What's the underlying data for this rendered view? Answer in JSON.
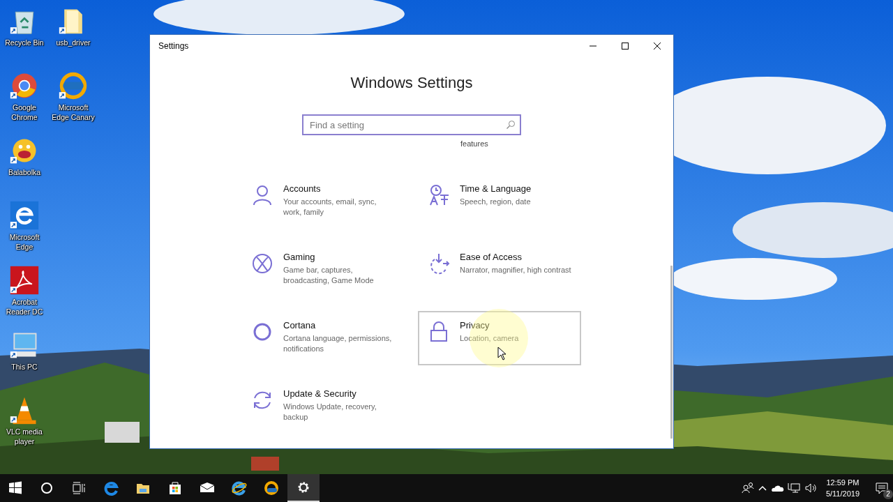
{
  "desktop_icons": [
    [
      {
        "label": "Recycle Bin",
        "kind": "bin"
      },
      {
        "label": "usb_driver",
        "kind": "folder"
      }
    ],
    [
      {
        "label": "Google Chrome",
        "kind": "chrome"
      },
      {
        "label": "Microsoft Edge Canary",
        "kind": "canary"
      }
    ],
    [
      {
        "label": "Balabolka",
        "kind": "smiley"
      }
    ],
    [
      {
        "label": "Microsoft Edge",
        "kind": "edge"
      }
    ],
    [
      {
        "label": "Acrobat Reader DC",
        "kind": "acrobat"
      }
    ],
    [
      {
        "label": "This PC",
        "kind": "pc"
      }
    ],
    [
      {
        "label": "VLC media player",
        "kind": "vlc"
      }
    ]
  ],
  "window": {
    "title": "Settings",
    "heading": "Windows Settings",
    "search": {
      "placeholder": "Find a setting"
    },
    "partial_text": "features"
  },
  "categories": [
    {
      "title": "Accounts",
      "description": "Your accounts, email, sync, work, family",
      "kind": "person",
      "selected": false
    },
    {
      "title": "Time & Language",
      "description": "Speech, region, date",
      "kind": "time",
      "selected": false
    },
    {
      "title": "Gaming",
      "description": "Game bar, captures, broadcasting, Game Mode",
      "kind": "xbox",
      "selected": false
    },
    {
      "title": "Ease of Access",
      "description": "Narrator, magnifier, high contrast",
      "kind": "ease",
      "selected": false
    },
    {
      "title": "Cortana",
      "description": "Cortana language, permissions, notifications",
      "kind": "ring",
      "selected": false
    },
    {
      "title": "Privacy",
      "description": "Location, camera",
      "kind": "lock",
      "selected": true
    },
    {
      "title": "Update & Security",
      "description": "Windows Update, recovery, backup",
      "kind": "sync",
      "selected": false
    }
  ],
  "taskbar": {
    "apps": [
      {
        "kind": "start",
        "active": false
      },
      {
        "kind": "cortana",
        "active": false
      },
      {
        "kind": "taskview",
        "active": false
      },
      {
        "kind": "edge",
        "active": false
      },
      {
        "kind": "explorer",
        "active": false
      },
      {
        "kind": "store",
        "active": false
      },
      {
        "kind": "mail",
        "active": false
      },
      {
        "kind": "ie",
        "active": false
      },
      {
        "kind": "canary",
        "active": false
      },
      {
        "kind": "settings",
        "active": true
      }
    ],
    "time": "12:59 PM",
    "date": "5/11/2019",
    "notifications": "2"
  }
}
